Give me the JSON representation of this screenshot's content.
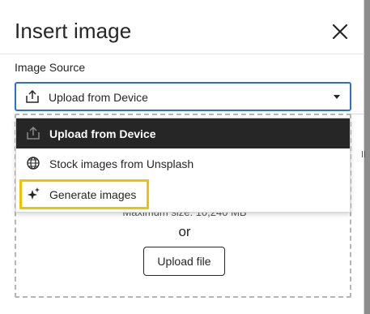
{
  "dialog": {
    "title": "Insert image",
    "close_icon": "close-icon"
  },
  "image_source": {
    "label": "Image Source",
    "selected_value": "Upload from Device",
    "selected_icon": "upload-icon",
    "options": [
      {
        "label": "Upload from Device",
        "icon": "upload-icon",
        "selected": true
      },
      {
        "label": "Stock images from Unsplash",
        "icon": "globe-icon",
        "selected": false
      },
      {
        "label": "Generate images",
        "icon": "sparkle-icon",
        "selected": false,
        "highlighted": true
      }
    ]
  },
  "upload_area": {
    "max_size": "Maximum size: 10,240 MB",
    "or_text": "or",
    "upload_button_label": "Upload file"
  },
  "colors": {
    "accent_border": "#2f6fcd",
    "selected_option_bg": "#262626",
    "highlight": "#f2c200"
  }
}
